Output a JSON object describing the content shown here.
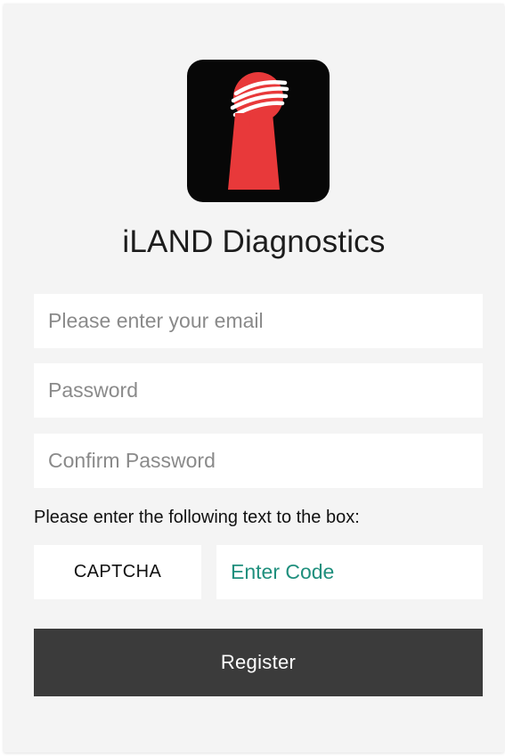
{
  "app": {
    "title": "iLAND Diagnostics",
    "logo_icon": "iland-logo-icon"
  },
  "form": {
    "email_placeholder": "Please enter your email",
    "email_value": "",
    "password_placeholder": "Password",
    "password_value": "",
    "confirm_placeholder": "Confirm Password",
    "confirm_value": "",
    "captcha_prompt": "Please enter the following text to the box:",
    "captcha_text": "CAPTCHA",
    "code_placeholder": "Enter Code",
    "code_value": "",
    "register_label": "Register"
  },
  "colors": {
    "background": "#f4f4f4",
    "logo_background": "#070707",
    "logo_red": "#e8393a",
    "accent_teal": "#1f8f7d",
    "button_background": "#3b3b3b",
    "button_text": "#ffffff"
  }
}
